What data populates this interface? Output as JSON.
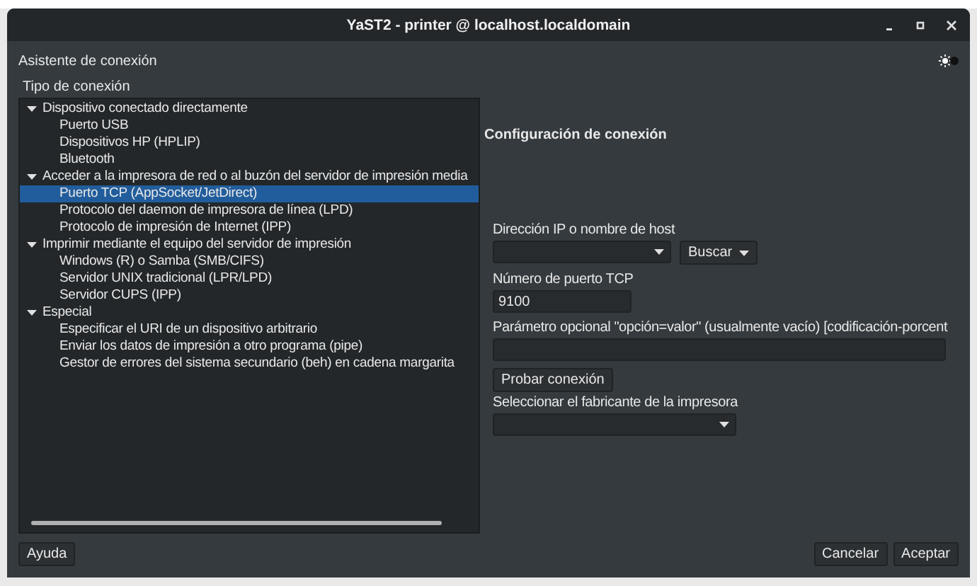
{
  "window": {
    "title": "YaST2 - printer @ localhost.localdomain"
  },
  "dialog_title": "Asistente de conexión",
  "connection_type": {
    "label": "Tipo de conexión",
    "groups": [
      {
        "label": "Dispositivo conectado directamente",
        "expanded": true,
        "children": [
          {
            "label": "Puerto USB",
            "selected": false
          },
          {
            "label": "Dispositivos HP (HPLIP)",
            "selected": false
          },
          {
            "label": "Bluetooth",
            "selected": false
          }
        ]
      },
      {
        "label": "Acceder a la impresora de red o al buzón del servidor de impresión media",
        "expanded": true,
        "children": [
          {
            "label": "Puerto TCP (AppSocket/JetDirect)",
            "selected": true
          },
          {
            "label": "Protocolo del daemon de impresora de línea (LPD)",
            "selected": false
          },
          {
            "label": "Protocolo de impresión de Internet (IPP)",
            "selected": false
          }
        ]
      },
      {
        "label": "Imprimir mediante el equipo del servidor de impresión",
        "expanded": true,
        "children": [
          {
            "label": "Windows (R) o Samba (SMB/CIFS)",
            "selected": false
          },
          {
            "label": "Servidor UNIX tradicional (LPR/LPD)",
            "selected": false
          },
          {
            "label": "Servidor CUPS (IPP)",
            "selected": false
          }
        ]
      },
      {
        "label": "Especial",
        "expanded": true,
        "children": [
          {
            "label": "Especificar el URI de un dispositivo arbitrario",
            "selected": false
          },
          {
            "label": "Enviar los datos de impresión a otro programa (pipe)",
            "selected": false
          },
          {
            "label": "Gestor de errores del sistema secundario (beh) en cadena margarita",
            "selected": false
          }
        ]
      }
    ]
  },
  "settings": {
    "title": "Configuración de conexión",
    "host": {
      "label": "Dirección IP o nombre de host",
      "search_button": "Buscar"
    },
    "port": {
      "label": "Número de puerto TCP",
      "value": "9100"
    },
    "option": {
      "label": "Parámetro opcional \"opción=valor\" (usualmente vacío) [codificación-porcent"
    },
    "test_button": "Probar conexión",
    "manufacturer": {
      "label": "Seleccionar el fabricante de la impresora"
    }
  },
  "buttons": {
    "help": "Ayuda",
    "cancel": "Cancelar",
    "accept": "Aceptar"
  }
}
